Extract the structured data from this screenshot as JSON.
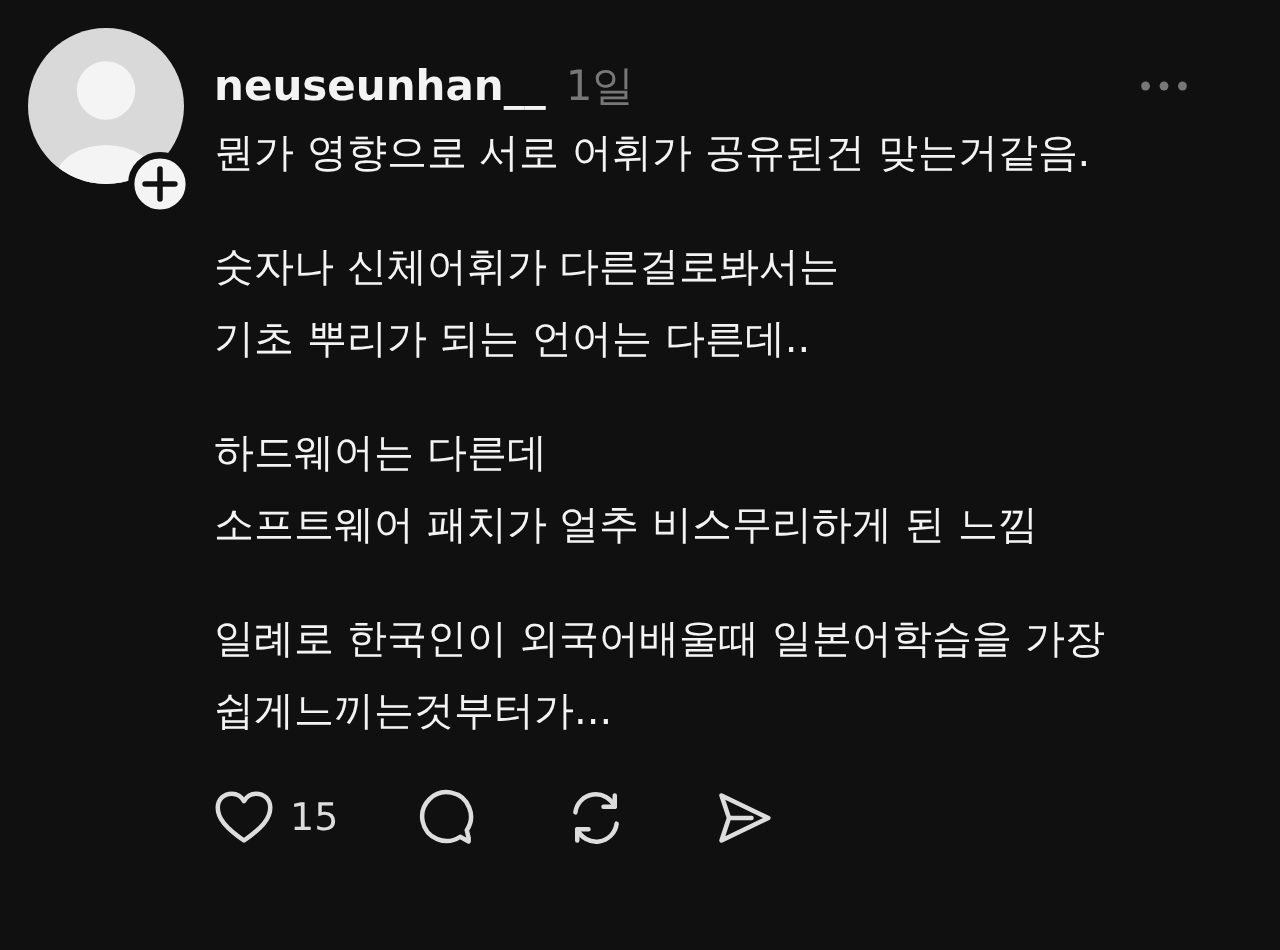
{
  "post": {
    "username": "neuseunhan__",
    "time": "1일",
    "paragraphs": [
      "뭔가 영향으로 서로 어휘가 공유된건 맞는거같음.",
      "숫자나 신체어휘가 다른걸로봐서는\n기초 뿌리가 되는 언어는 다른데..",
      "하드웨어는 다른데\n소프트웨어 패치가 얼추 비스무리하게 된 느낌",
      "일례로 한국인이 외국어배울때 일본어학습을 가장\n쉽게느끼는것부터가..."
    ],
    "actions": {
      "like_count": "15"
    }
  }
}
